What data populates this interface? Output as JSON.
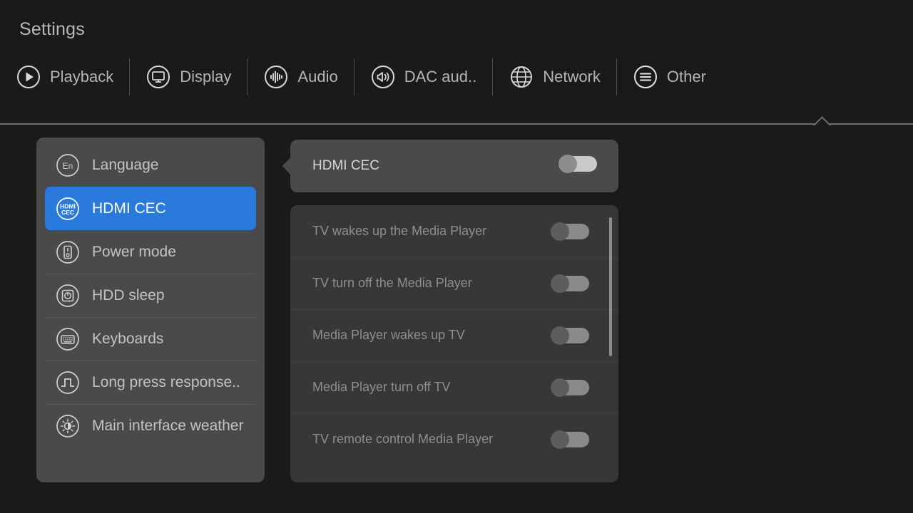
{
  "app": {
    "title": "Settings"
  },
  "nav": {
    "items": [
      {
        "label": "Playback",
        "icon": "play-circle-icon",
        "active": false
      },
      {
        "label": "Display",
        "icon": "monitor-icon",
        "active": false
      },
      {
        "label": "Audio",
        "icon": "audio-wave-icon",
        "active": false
      },
      {
        "label": "DAC aud..",
        "icon": "speaker-icon",
        "active": false
      },
      {
        "label": "Network",
        "icon": "globe-icon",
        "active": false
      },
      {
        "label": "Other",
        "icon": "hamburger-list-icon",
        "active": true
      }
    ]
  },
  "sidebar": {
    "items": [
      {
        "label": "Language",
        "icon": "language-en-icon",
        "selected": false
      },
      {
        "label": "HDMI CEC",
        "icon": "hdmi-cec-icon",
        "selected": true
      },
      {
        "label": "Power mode",
        "icon": "power-mode-icon",
        "selected": false
      },
      {
        "label": "HDD sleep",
        "icon": "hdd-sleep-icon",
        "selected": false
      },
      {
        "label": "Keyboards",
        "icon": "keyboard-icon",
        "selected": false
      },
      {
        "label": "Long press response..",
        "icon": "pulse-wave-icon",
        "selected": false
      },
      {
        "label": "Main interface weather",
        "icon": "sun-weather-icon",
        "selected": false
      }
    ]
  },
  "main": {
    "header": {
      "label": "HDMI CEC",
      "toggle_state": "off",
      "enabled": true
    },
    "options": [
      {
        "label": "TV wakes up the Media Player",
        "toggle_state": "off",
        "enabled": false
      },
      {
        "label": "TV turn off the Media Player",
        "toggle_state": "off",
        "enabled": false
      },
      {
        "label": "Media Player wakes up TV",
        "toggle_state": "off",
        "enabled": false
      },
      {
        "label": "Media Player turn off TV",
        "toggle_state": "off",
        "enabled": false
      },
      {
        "label": "TV remote control Media Player",
        "toggle_state": "off",
        "enabled": false
      }
    ],
    "scrollbar": {
      "visible": true
    }
  },
  "colors": {
    "background": "#1a1a1a",
    "panel": "#4a4a4a",
    "list_panel": "#373737",
    "accent": "#2a7ade",
    "text_primary": "#c2c2c2",
    "text_dim": "#8e8e8e"
  }
}
